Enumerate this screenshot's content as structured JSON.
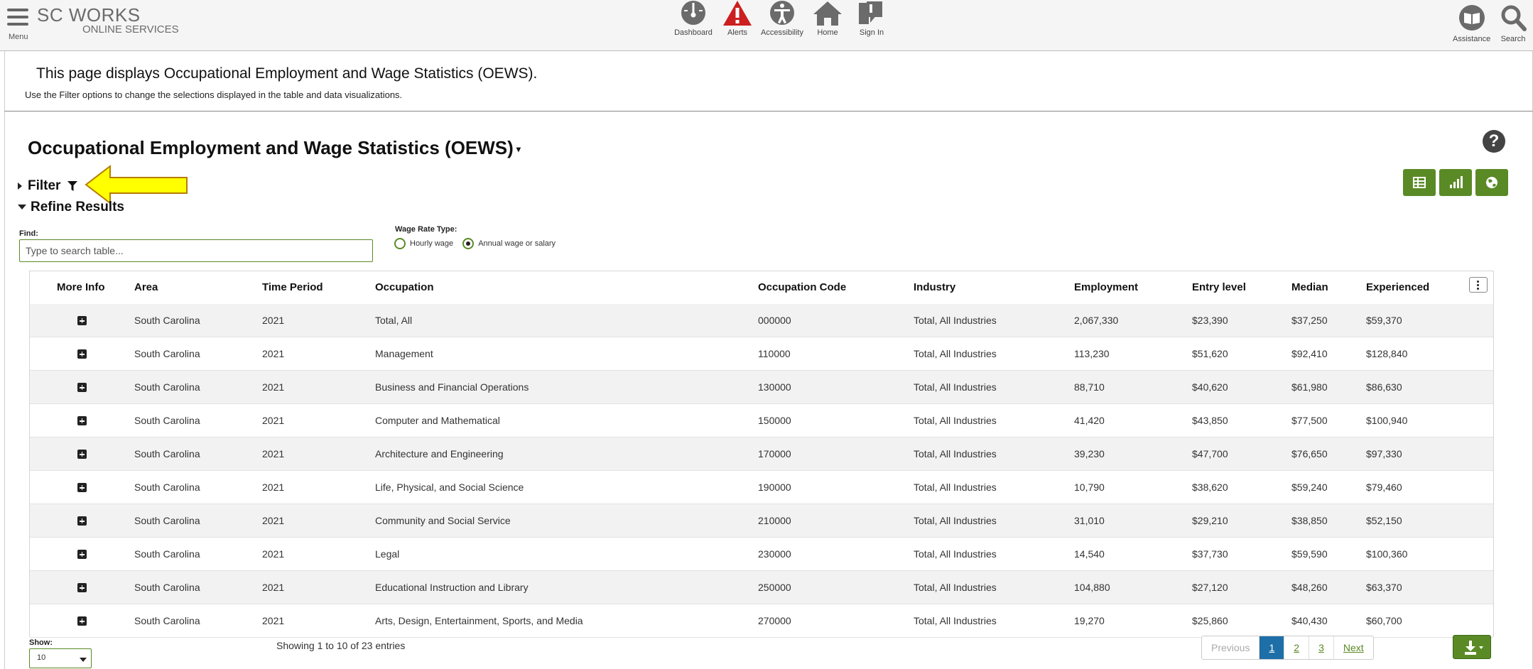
{
  "topbar": {
    "menu_label": "Menu",
    "logo_top": "SC WORKS",
    "logo_sub": "ONLINE SERVICES",
    "nav": [
      {
        "label": "Dashboard",
        "icon": "dashboard-icon"
      },
      {
        "label": "Alerts",
        "icon": "alert-icon"
      },
      {
        "label": "Accessibility",
        "icon": "accessibility-icon"
      },
      {
        "label": "Home",
        "icon": "home-icon"
      },
      {
        "label": "Sign In",
        "icon": "sign-in-icon"
      }
    ],
    "right": [
      {
        "label": "Assistance",
        "icon": "book-icon"
      },
      {
        "label": "Search",
        "icon": "search-icon"
      }
    ]
  },
  "intro": {
    "title": "This page displays Occupational Employment and Wage Statistics (OEWS).",
    "subtitle": "Use the Filter options to change the selections displayed in the table and data visualizations."
  },
  "main": {
    "title": "Occupational Employment and Wage Statistics (OEWS)",
    "filter_label": "Filter",
    "refine_label": "Refine Results",
    "find_label": "Find:",
    "find_placeholder": "Type to search table...",
    "wage_rate_label": "Wage Rate Type:",
    "wage_options": [
      {
        "label": "Hourly wage",
        "selected": false
      },
      {
        "label": "Annual wage or salary",
        "selected": true
      }
    ],
    "view_buttons": [
      "table-view-icon",
      "chart-view-icon",
      "map-view-icon"
    ],
    "accent_color": "#5a8a26",
    "annotation_color": "#ffff00"
  },
  "table": {
    "columns": [
      "More Info",
      "Area",
      "Time Period",
      "Occupation",
      "Occupation Code",
      "Industry",
      "Employment",
      "Entry level",
      "Median",
      "Experienced"
    ],
    "rows": [
      [
        "South Carolina",
        "2021",
        "Total, All",
        "000000",
        "Total, All Industries",
        "2,067,330",
        "$23,390",
        "$37,250",
        "$59,370"
      ],
      [
        "South Carolina",
        "2021",
        "Management",
        "110000",
        "Total, All Industries",
        "113,230",
        "$51,620",
        "$92,410",
        "$128,840"
      ],
      [
        "South Carolina",
        "2021",
        "Business and Financial Operations",
        "130000",
        "Total, All Industries",
        "88,710",
        "$40,620",
        "$61,980",
        "$86,630"
      ],
      [
        "South Carolina",
        "2021",
        "Computer and Mathematical",
        "150000",
        "Total, All Industries",
        "41,420",
        "$43,850",
        "$77,500",
        "$100,940"
      ],
      [
        "South Carolina",
        "2021",
        "Architecture and Engineering",
        "170000",
        "Total, All Industries",
        "39,230",
        "$47,700",
        "$76,650",
        "$97,330"
      ],
      [
        "South Carolina",
        "2021",
        "Life, Physical, and Social Science",
        "190000",
        "Total, All Industries",
        "10,790",
        "$38,620",
        "$59,240",
        "$79,460"
      ],
      [
        "South Carolina",
        "2021",
        "Community and Social Service",
        "210000",
        "Total, All Industries",
        "31,010",
        "$29,210",
        "$38,850",
        "$52,150"
      ],
      [
        "South Carolina",
        "2021",
        "Legal",
        "230000",
        "Total, All Industries",
        "14,540",
        "$37,730",
        "$59,590",
        "$100,360"
      ],
      [
        "South Carolina",
        "2021",
        "Educational Instruction and Library",
        "250000",
        "Total, All Industries",
        "104,880",
        "$27,120",
        "$48,260",
        "$63,370"
      ],
      [
        "South Carolina",
        "2021",
        "Arts, Design, Entertainment, Sports, and Media",
        "270000",
        "Total, All Industries",
        "19,270",
        "$25,860",
        "$40,430",
        "$60,700"
      ]
    ]
  },
  "footer": {
    "show_label": "Show:",
    "show_value": "10",
    "entries_text": "Showing 1 to 10 of 23 entries",
    "pager": {
      "previous": "Previous",
      "pages": [
        "1",
        "2",
        "3"
      ],
      "active": "1",
      "next": "Next"
    }
  }
}
